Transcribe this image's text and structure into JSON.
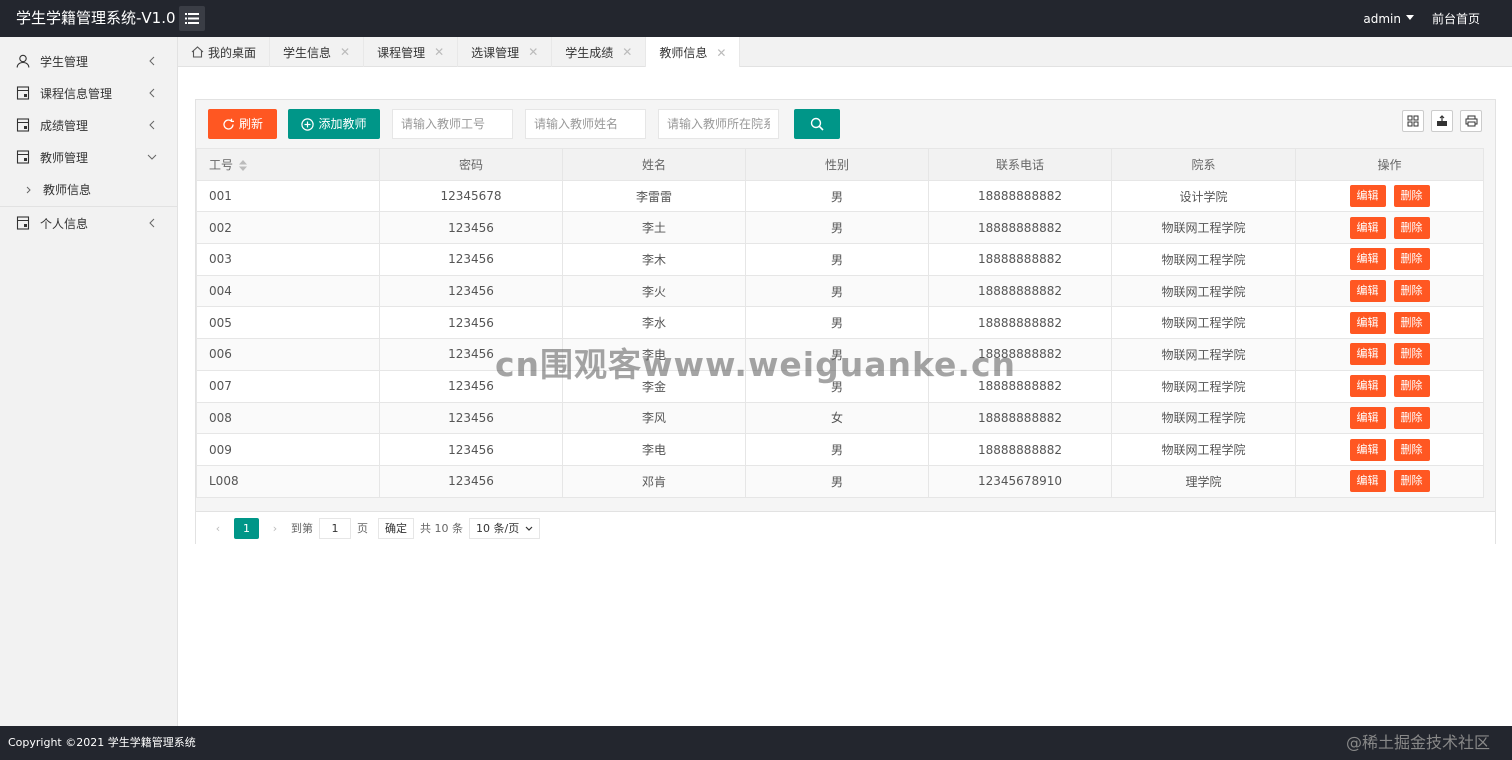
{
  "header": {
    "title": "学生学籍管理系统-V1.0",
    "user": "admin",
    "home_link": "前台首页"
  },
  "sidebar": {
    "items": [
      {
        "label": "学生管理",
        "icon": "user-icon"
      },
      {
        "label": "课程信息管理",
        "icon": "document-icon"
      },
      {
        "label": "成绩管理",
        "icon": "document-icon"
      },
      {
        "label": "教师管理",
        "icon": "document-icon",
        "expanded": true
      },
      {
        "label": "个人信息",
        "icon": "document-icon"
      }
    ],
    "sub_items": [
      {
        "label": "教师信息"
      }
    ]
  },
  "tabs": [
    {
      "label": "我的桌面",
      "closable": false
    },
    {
      "label": "学生信息",
      "closable": true
    },
    {
      "label": "课程管理",
      "closable": true
    },
    {
      "label": "选课管理",
      "closable": true
    },
    {
      "label": "学生成绩",
      "closable": true
    },
    {
      "label": "教师信息",
      "closable": true,
      "active": true
    }
  ],
  "toolbar": {
    "refresh_label": "刷新",
    "add_label": "添加教师",
    "search_id_placeholder": "请输入教师工号",
    "search_name_placeholder": "请输入教师姓名",
    "search_dept_placeholder": "请输入教师所在院系"
  },
  "table": {
    "columns": [
      "工号",
      "密码",
      "姓名",
      "性别",
      "联系电话",
      "院系",
      "操作"
    ],
    "edit_label": "编辑",
    "delete_label": "删除",
    "rows": [
      [
        "001",
        "12345678",
        "李雷雷",
        "男",
        "18888888882",
        "设计学院"
      ],
      [
        "002",
        "123456",
        "李土",
        "男",
        "18888888882",
        "物联网工程学院"
      ],
      [
        "003",
        "123456",
        "李木",
        "男",
        "18888888882",
        "物联网工程学院"
      ],
      [
        "004",
        "123456",
        "李火",
        "男",
        "18888888882",
        "物联网工程学院"
      ],
      [
        "005",
        "123456",
        "李水",
        "男",
        "18888888882",
        "物联网工程学院"
      ],
      [
        "006",
        "123456",
        "李电",
        "男",
        "18888888882",
        "物联网工程学院"
      ],
      [
        "007",
        "123456",
        "李金",
        "男",
        "18888888882",
        "物联网工程学院"
      ],
      [
        "008",
        "123456",
        "李风",
        "女",
        "18888888882",
        "物联网工程学院"
      ],
      [
        "009",
        "123456",
        "李电",
        "男",
        "18888888882",
        "物联网工程学院"
      ],
      [
        "L008",
        "123456",
        "邓肯",
        "男",
        "12345678910",
        "理学院"
      ]
    ]
  },
  "pager": {
    "current_page": "1",
    "goto_label": "到第",
    "page_input": "1",
    "page_unit": "页",
    "confirm_label": "确定",
    "total_label": "共 10 条",
    "page_size": "10 条/页"
  },
  "footer": {
    "copyright": "Copyright ©2021 学生学籍管理系统",
    "watermark": "@稀土掘金技术社区"
  },
  "watermark": "cn围观客www.weiguanke.cn",
  "colors": {
    "header_bg": "#23262e",
    "danger": "#ff5722",
    "primary": "#009688"
  }
}
